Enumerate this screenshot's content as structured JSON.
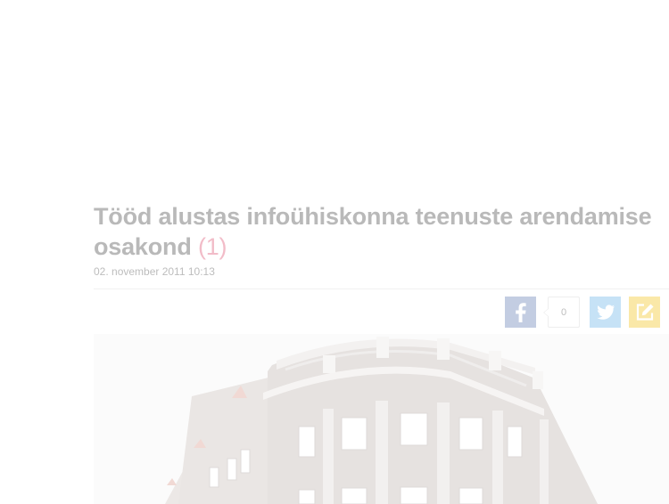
{
  "article": {
    "title": "Tööd alustas infoühiskonna teenuste arendamise osakond",
    "comment_count": "(1)",
    "date": "02. november 2011 10:13"
  },
  "share": {
    "facebook_icon": "facebook-icon",
    "share_count": "0",
    "twitter_icon": "twitter-icon",
    "edit_icon": "edit-icon",
    "colors": {
      "facebook": "#c3cde2",
      "twitter": "#c6e2f6",
      "edit": "#fae8a8"
    }
  },
  "image": {
    "subject": "building-photo"
  }
}
